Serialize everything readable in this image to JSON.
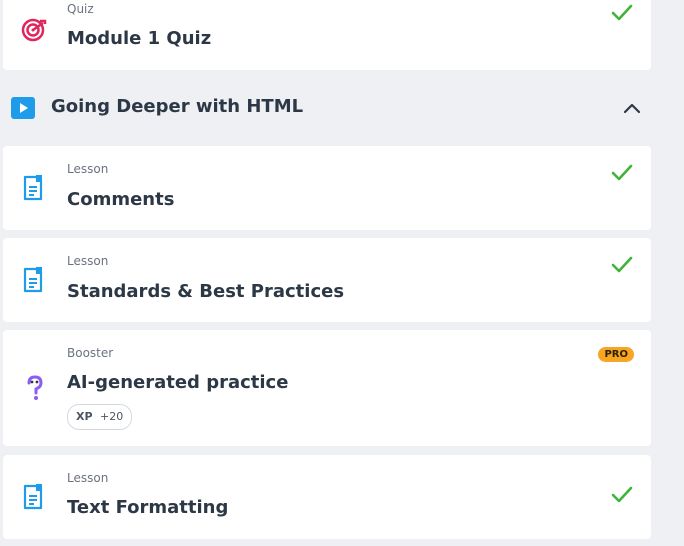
{
  "quiz_card": {
    "type": "Quiz",
    "title": "Module 1 Quiz",
    "icon": "target-icon",
    "completed": true
  },
  "section": {
    "title": "Going Deeper with HTML",
    "icon": "play-icon",
    "state_icon": "chevron-up-icon"
  },
  "items": [
    {
      "type": "Lesson",
      "title": "Comments",
      "icon": "lesson-document-icon",
      "completed": true
    },
    {
      "type": "Lesson",
      "title": "Standards & Best Practices",
      "icon": "lesson-document-icon",
      "completed": true
    },
    {
      "type": "Booster",
      "title": "AI-generated practice",
      "icon": "question-mark-icon",
      "badge": "PRO",
      "xp_label": "XP",
      "xp_value": "+20"
    },
    {
      "type": "Lesson",
      "title": "Text Formatting",
      "icon": "lesson-document-icon",
      "completed": true
    }
  ],
  "colors": {
    "check": "#3eb53a",
    "accent": "#1e9be9",
    "quiz_icon": "#e0245e",
    "booster_icon": "#8b5cf6",
    "pro_badge": "#f6a623",
    "background": "#eef0f3"
  }
}
